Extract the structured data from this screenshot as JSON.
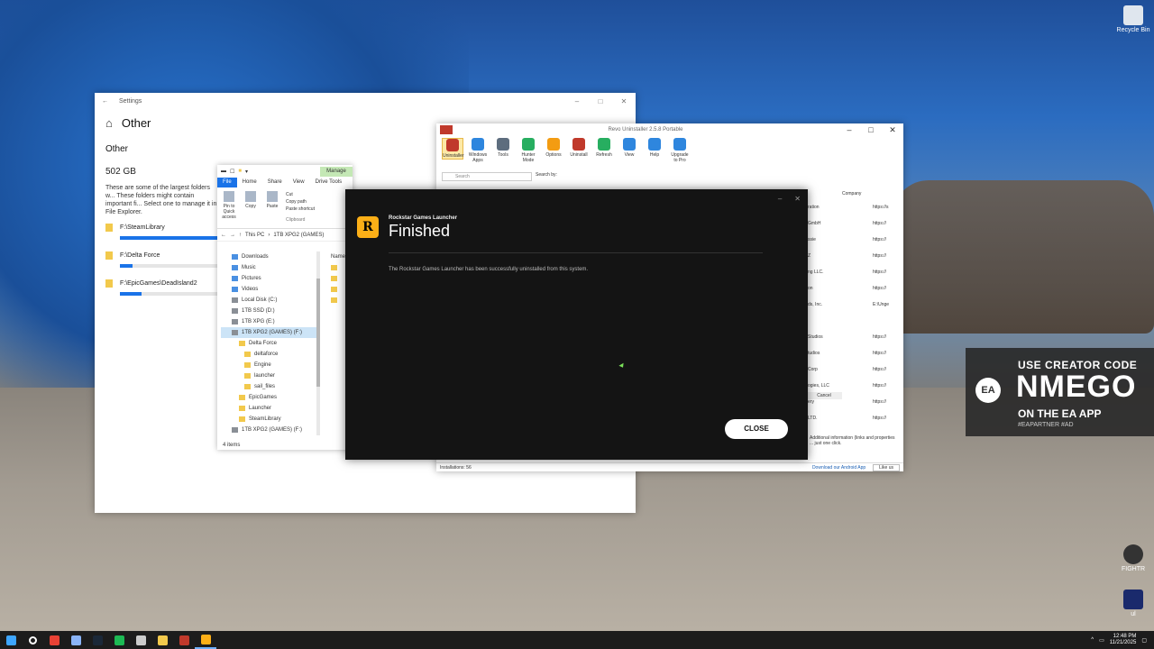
{
  "desktop": {
    "recycle_bin_label": "Recycle Bin",
    "fightr_label": "FIGHTR",
    "app_icon_label": "ul"
  },
  "settings": {
    "window_title": "Settings",
    "page_title": "Other",
    "subtitle": "Other",
    "size": "502 GB",
    "description": "These are some of the largest folders w... These folders might contain important fi... Select one to manage it in File Explorer.",
    "folders": [
      {
        "path": "F:\\SteamLibrary",
        "fill": 0.9
      },
      {
        "path": "F:\\Delta Force",
        "fill": 0.12
      },
      {
        "path": "F:\\EpicGames\\DeadIsland2",
        "fill": 0.2
      }
    ]
  },
  "explorer": {
    "manage_tab": "Manage",
    "drive_label": "1TB XPG2 (GAMES) (F:)",
    "tabs": [
      "File",
      "Home",
      "Share",
      "View",
      "Drive Tools"
    ],
    "ribbon": [
      "Pin to Quick access",
      "Copy",
      "Paste",
      "Cut",
      "Copy path",
      "Paste shortcut"
    ],
    "clipboard": "Clipboard",
    "address": [
      "This PC",
      "1TB XPG2 (GAMES)"
    ],
    "nav_items": [
      {
        "label": "Downloads",
        "icon": "download-icon"
      },
      {
        "label": "Music",
        "icon": "music-icon"
      },
      {
        "label": "Pictures",
        "icon": "pictures-icon"
      },
      {
        "label": "Videos",
        "icon": "videos-icon"
      },
      {
        "label": "Local Disk (C:)",
        "icon": "drive-icon"
      },
      {
        "label": "1TB SSD (D:)",
        "icon": "drive-icon"
      },
      {
        "label": "1TB XPG (E:)",
        "icon": "drive-icon"
      },
      {
        "label": "1TB XPG2 (GAMES) (F:)",
        "icon": "drive-icon",
        "selected": true
      },
      {
        "label": "Delta Force",
        "icon": "folder-icon"
      },
      {
        "label": "deltaforce",
        "icon": "folder-icon"
      },
      {
        "label": "Engine",
        "icon": "folder-icon"
      },
      {
        "label": "launcher",
        "icon": "folder-icon"
      },
      {
        "label": "sail_files",
        "icon": "folder-icon"
      },
      {
        "label": "EpicGames",
        "icon": "folder-icon"
      },
      {
        "label": "Launcher",
        "icon": "folder-icon"
      },
      {
        "label": "SteamLibrary",
        "icon": "folder-icon"
      },
      {
        "label": "1TB XPG2 (GAMES) (F:)",
        "icon": "drive-icon"
      }
    ],
    "column_header": "Name",
    "status": "4 items"
  },
  "revo": {
    "window_title": "Revo Uninstaller 2.5.8 Portable",
    "toolbar": [
      {
        "label": "Uninstaller",
        "color": "#c0392b",
        "selected": true
      },
      {
        "label": "Windows Apps",
        "color": "#2e86de"
      },
      {
        "label": "Tools",
        "color": "#5d6d7e"
      },
      {
        "label": "Hunter Mode",
        "color": "#27ae60"
      },
      {
        "label": "Options",
        "color": "#f39c12"
      },
      {
        "label": "Uninstall",
        "color": "#c0392b"
      },
      {
        "label": "Refresh",
        "color": "#27ae60"
      },
      {
        "label": "View",
        "color": "#2e86de"
      },
      {
        "label": "Help",
        "color": "#2e86de"
      },
      {
        "label": "Upgrade to Pro",
        "color": "#2e86de"
      }
    ],
    "search_placeholder": "Search",
    "search_by": "Search by:",
    "column_header": "Company",
    "companies": [
      "ration",
      "GmbH",
      "ssie",
      "Z",
      "ng LLC.",
      "on",
      "ds, Inc.",
      "",
      "Studios",
      "tudios",
      "Corp",
      "ogies, LLC",
      "ery",
      "LTD."
    ],
    "links": [
      "https://s",
      "https://",
      "https://",
      "https://",
      "https://",
      "https://",
      "E:\\Unge",
      "",
      "https://",
      "https://",
      "https://",
      "https://",
      "https://",
      "https://"
    ],
    "cancel": "Cancel",
    "note": "Additional information (links and properties ... just one click.",
    "installations": "Installations: 56",
    "download": "Download our Android App",
    "like": "Like us"
  },
  "rockstar": {
    "app_name": "Rockstar Games Launcher",
    "heading": "Finished",
    "message": "The Rockstar Games Launcher has been successfully uninstalled from this system.",
    "close_label": "CLOSE",
    "logo_letter": "R"
  },
  "ea_banner": {
    "line1": "USE CREATOR CODE",
    "line2": "NMEGO",
    "line3": "ON THE EA APP",
    "line4": "#EAPARTNER #AD",
    "logo": "EA"
  },
  "taskbar": {
    "time": "12:48 PM",
    "date": "11/21/2025",
    "apps": [
      {
        "name": "start-icon",
        "color": "#3ea6ff"
      },
      {
        "name": "search-icon",
        "color": "#ffffff"
      },
      {
        "name": "chrome-icon",
        "color": "#e94235"
      },
      {
        "name": "app-icon",
        "color": "#8ab4f8"
      },
      {
        "name": "steam-icon",
        "color": "#1b2838"
      },
      {
        "name": "spotify-icon",
        "color": "#1db954"
      },
      {
        "name": "settings-icon",
        "color": "#cccccc"
      },
      {
        "name": "file-explorer-icon",
        "color": "#f2c94c"
      },
      {
        "name": "revo-icon",
        "color": "#c0392b"
      },
      {
        "name": "rockstar-icon",
        "color": "#fcaf17"
      }
    ]
  }
}
